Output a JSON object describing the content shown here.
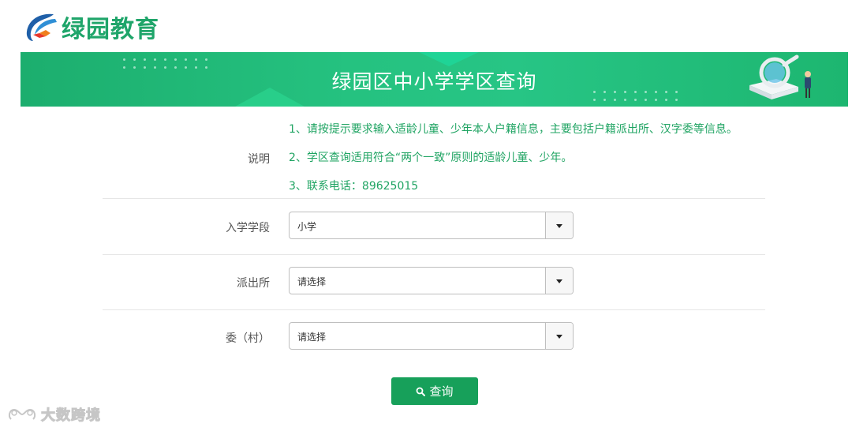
{
  "brand": {
    "name": "绿园教育",
    "accent_color": "#1fa56a",
    "logo_icon": "book-swoosh-icon"
  },
  "banner": {
    "title": "绿园区中小学学区查询",
    "illustration": "magnifier-student-illustration"
  },
  "info": {
    "label": "说明",
    "lines": [
      "1、请按提示要求输入适龄儿童、少年本人户籍信息，主要包括户籍派出所、汉字委等信息。",
      "2、学区查询适用符合“两个一致”原则的适龄儿童、少年。",
      "3、联系电话：89625015"
    ],
    "text_color": "#20a463"
  },
  "form": {
    "fields": [
      {
        "label": "入学学段",
        "value": "小学",
        "icon": "caret-down-icon"
      },
      {
        "label": "派出所",
        "value": "请选择",
        "icon": "caret-down-icon"
      },
      {
        "label": "委（村）",
        "value": "请选择",
        "icon": "caret-down-icon"
      }
    ],
    "query_button": {
      "label": "查询",
      "icon": "search-icon",
      "color": "#17a05a"
    }
  },
  "watermark": {
    "text": "大数跨境",
    "icon": "infinity-logo-icon"
  }
}
